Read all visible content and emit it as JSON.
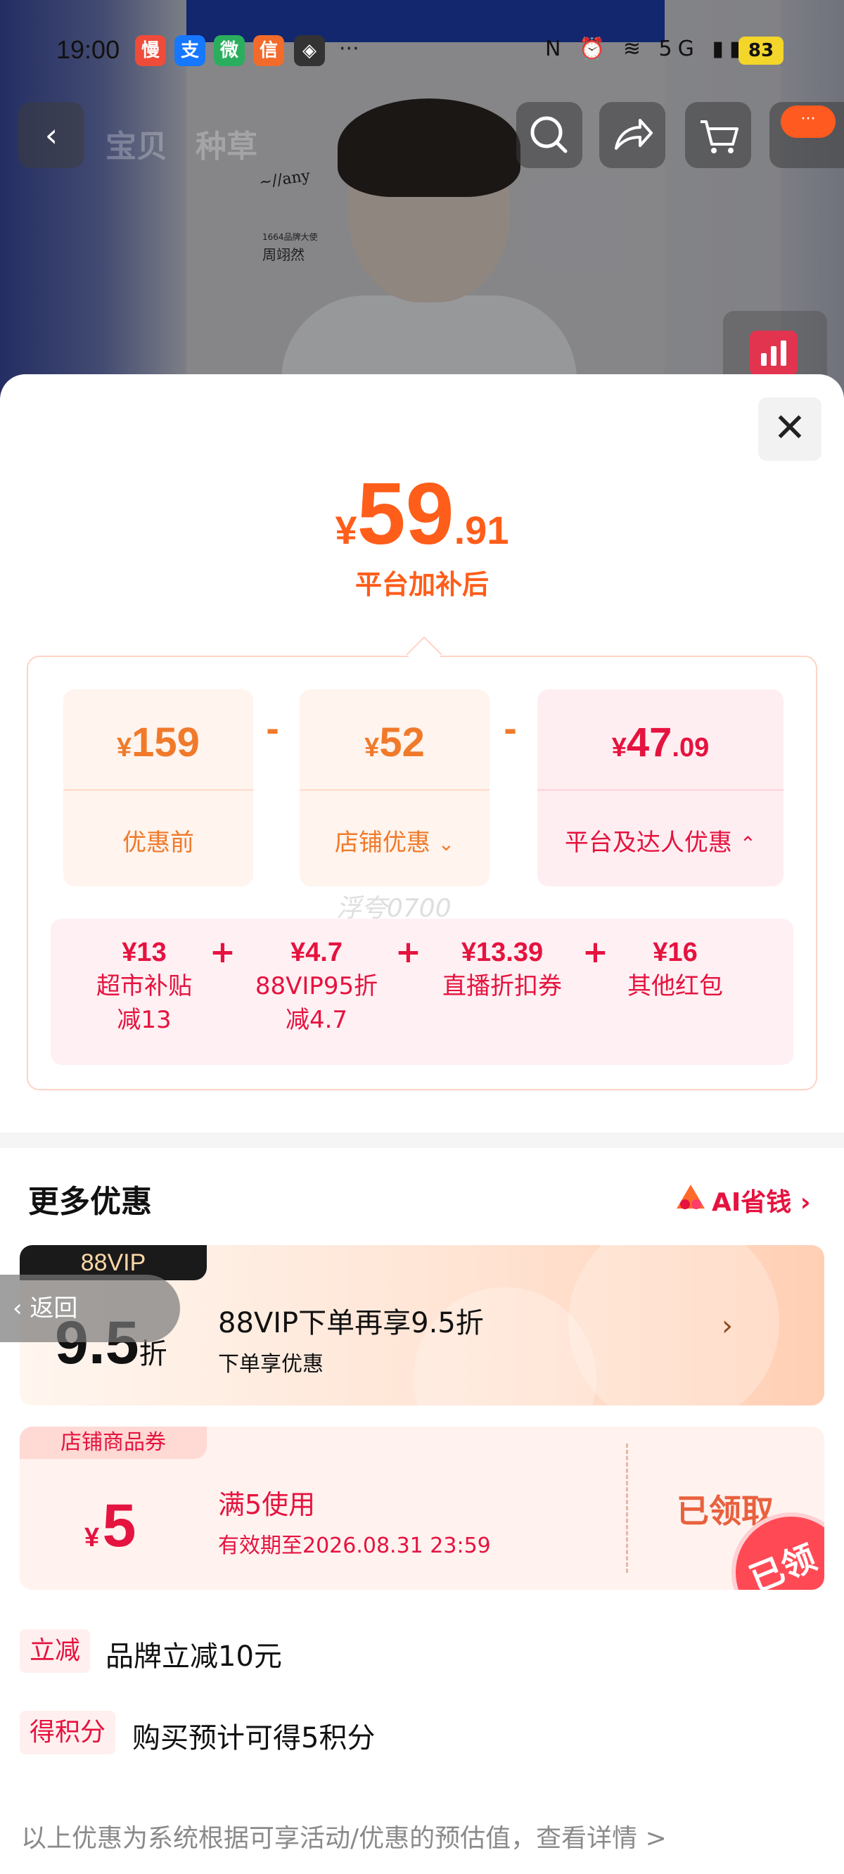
{
  "status_bar": {
    "time": "19:00",
    "app_icons": [
      "慢",
      "支",
      "微",
      "信"
    ],
    "dots": "···",
    "system_icons": "N ⏰ ≋ 5G ▮▮▮",
    "battery": "83"
  },
  "background": {
    "brand_caption": "1664品牌大使",
    "brand_name": "周翊然"
  },
  "nav": {
    "back_icon": "‹",
    "tabs": [
      "宝贝",
      "种草"
    ],
    "more_label": "···"
  },
  "sheet": {
    "close_icon": "✕",
    "final_price": {
      "currency": "¥",
      "integer": "59",
      "decimal": ".91"
    },
    "final_price_label": "平台加补后",
    "breakdown": {
      "original": {
        "currency": "¥",
        "value": "159",
        "label": "优惠前"
      },
      "store": {
        "currency": "¥",
        "value": "52",
        "label": "店铺优惠"
      },
      "platform": {
        "currency": "¥",
        "integer": "47",
        "decimal": ".09",
        "label": "平台及达人优惠"
      },
      "minus": "-",
      "plus": "+",
      "sub_items": [
        {
          "value": "¥13",
          "label": "超市补贴",
          "note": "减13"
        },
        {
          "value": "¥4.7",
          "label": "88VIP95折",
          "note": "减4.7"
        },
        {
          "value": "¥13.39",
          "label": "直播折扣券",
          "note": ""
        },
        {
          "value": "¥16",
          "label": "其他红包",
          "note": ""
        }
      ],
      "watermark": "浮夸0700"
    },
    "more": {
      "title": "更多优惠",
      "ai_label": "AI省钱 ›",
      "vip_card": {
        "badge": "88VIP",
        "discount": "9.5",
        "unit": "折",
        "title": "88VIP下单再享9.5折",
        "subtitle": "下单享优惠",
        "arrow": "›"
      },
      "back_float": "‹ 返回",
      "coupon": {
        "tag": "店铺商品券",
        "currency": "¥",
        "amount": "5",
        "condition": "满5使用",
        "validity": "有效期至2026.08.31 23:59",
        "status": "已领取",
        "stamp": "已领"
      },
      "rows": [
        {
          "badge": "立减",
          "text": "品牌立减10元"
        },
        {
          "badge": "得积分",
          "text": "购买预计可得5积分"
        }
      ],
      "footnote": "以上优惠为系统根据可享活动/优惠的预估值，查看详情 >"
    }
  },
  "colors": {
    "accent_orange": "#ff5d1a",
    "accent_red": "#e5133f"
  }
}
